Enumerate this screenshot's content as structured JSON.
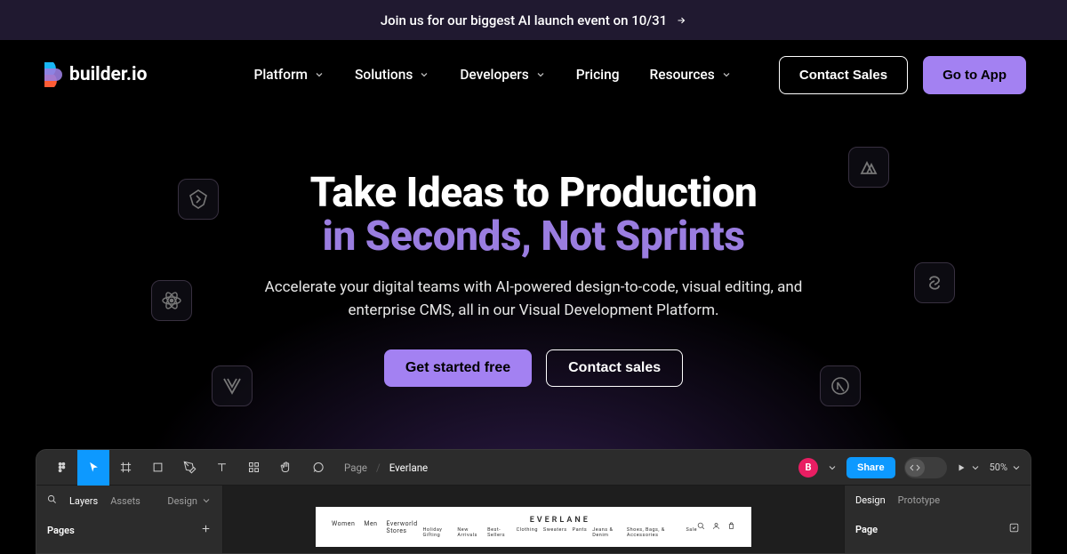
{
  "banner": {
    "text": "Join us for our biggest AI launch event on 10/31"
  },
  "brand": {
    "name": "builder.io"
  },
  "nav": {
    "items": [
      "Platform",
      "Solutions",
      "Developers",
      "Pricing",
      "Resources"
    ],
    "has_dropdown": [
      true,
      true,
      true,
      false,
      true
    ],
    "contact": "Contact Sales",
    "app": "Go to App"
  },
  "hero": {
    "line1": "Take Ideas to Production",
    "line2": "in Seconds, Not Sprints",
    "sub": "Accelerate your digital teams with AI-powered design-to-code, visual editing, and enterprise CMS, all in our Visual Development Platform.",
    "cta1": "Get started free",
    "cta2": "Contact sales"
  },
  "float_icons": [
    "qwik-icon",
    "react-icon",
    "vue-icon",
    "nuxt-icon",
    "svelte-icon",
    "next-icon"
  ],
  "figma": {
    "crumb_page": "Page",
    "crumb_file": "Everlane",
    "avatar": "B",
    "share": "Share",
    "zoom": "50%",
    "left_tabs": [
      "Layers",
      "Assets"
    ],
    "left_design": "Design",
    "left_section": "Pages",
    "right_tabs": [
      "Design",
      "Prototype"
    ],
    "right_section": "Page",
    "frame": {
      "left_items": [
        "Women",
        "Men",
        "Everworld Stores"
      ],
      "brand": "EVERLANE",
      "center_items": [
        "Holiday Gifting",
        "New Arrivals",
        "Best-Sellers",
        "Clothing",
        "Sweaters",
        "Pants",
        "Jeans & Denim",
        "Shoes, Bags, & Accessories",
        "Sale"
      ],
      "right_icons": [
        "search-icon",
        "user-icon",
        "cart-icon"
      ]
    }
  }
}
